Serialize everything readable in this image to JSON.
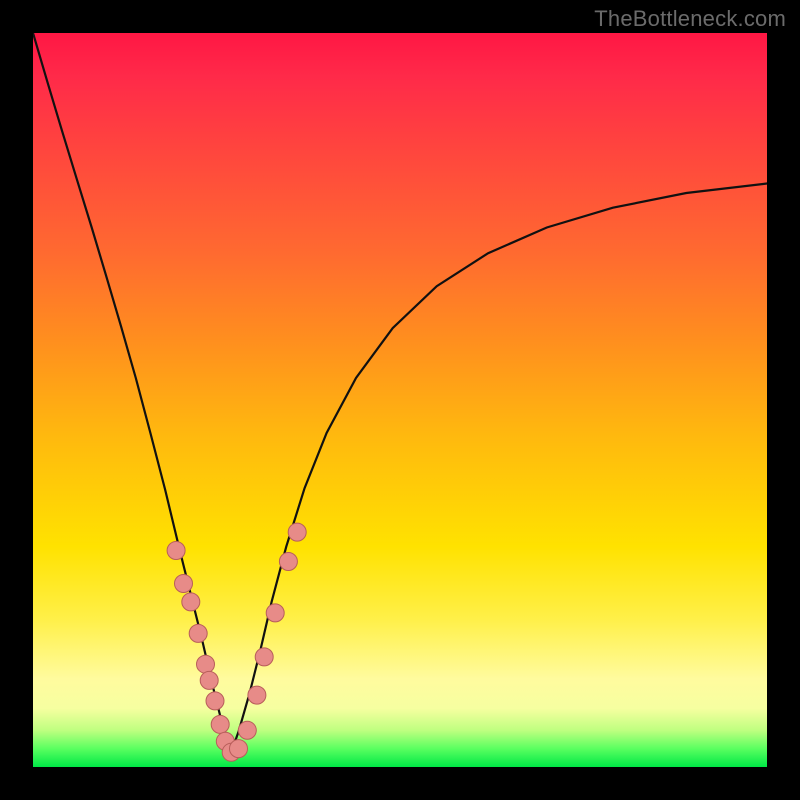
{
  "watermark": "TheBottleneck.com",
  "colors": {
    "frame": "#000000",
    "curve": "#111111",
    "dot_fill": "#e78b88",
    "dot_stroke": "#b85e5a",
    "gradient_stops": [
      {
        "pos": 0.0,
        "color": "#ff1744"
      },
      {
        "pos": 0.06,
        "color": "#ff2a49"
      },
      {
        "pos": 0.14,
        "color": "#ff4040"
      },
      {
        "pos": 0.3,
        "color": "#ff6a30"
      },
      {
        "pos": 0.42,
        "color": "#ff8f1e"
      },
      {
        "pos": 0.55,
        "color": "#ffb90e"
      },
      {
        "pos": 0.7,
        "color": "#ffe200"
      },
      {
        "pos": 0.8,
        "color": "#fff04a"
      },
      {
        "pos": 0.88,
        "color": "#fffb9e"
      },
      {
        "pos": 0.92,
        "color": "#f6ffa0"
      },
      {
        "pos": 0.95,
        "color": "#bfff80"
      },
      {
        "pos": 0.975,
        "color": "#5aff60"
      },
      {
        "pos": 1.0,
        "color": "#00e846"
      }
    ]
  },
  "chart_data": {
    "type": "line",
    "title": "",
    "xlabel": "",
    "ylabel": "",
    "xlim": [
      0,
      1
    ],
    "ylim": [
      0,
      1
    ],
    "vertex_x": 0.27,
    "series": [
      {
        "name": "bottleneck-curve",
        "x": [
          0.0,
          0.02,
          0.04,
          0.06,
          0.08,
          0.1,
          0.12,
          0.14,
          0.16,
          0.18,
          0.2,
          0.215,
          0.23,
          0.245,
          0.26,
          0.27,
          0.28,
          0.295,
          0.31,
          0.325,
          0.345,
          0.37,
          0.4,
          0.44,
          0.49,
          0.55,
          0.62,
          0.7,
          0.79,
          0.89,
          1.0
        ],
        "y": [
          1.0,
          0.932,
          0.865,
          0.8,
          0.735,
          0.668,
          0.6,
          0.53,
          0.455,
          0.378,
          0.295,
          0.235,
          0.175,
          0.11,
          0.05,
          0.02,
          0.048,
          0.1,
          0.16,
          0.225,
          0.3,
          0.38,
          0.455,
          0.53,
          0.598,
          0.655,
          0.7,
          0.735,
          0.762,
          0.782,
          0.795
        ]
      }
    ],
    "scatter": {
      "name": "sample-dots",
      "points": [
        {
          "x": 0.195,
          "y": 0.295
        },
        {
          "x": 0.205,
          "y": 0.25
        },
        {
          "x": 0.215,
          "y": 0.225
        },
        {
          "x": 0.225,
          "y": 0.182
        },
        {
          "x": 0.235,
          "y": 0.14
        },
        {
          "x": 0.24,
          "y": 0.118
        },
        {
          "x": 0.248,
          "y": 0.09
        },
        {
          "x": 0.255,
          "y": 0.058
        },
        {
          "x": 0.262,
          "y": 0.035
        },
        {
          "x": 0.27,
          "y": 0.02
        },
        {
          "x": 0.28,
          "y": 0.025
        },
        {
          "x": 0.292,
          "y": 0.05
        },
        {
          "x": 0.305,
          "y": 0.098
        },
        {
          "x": 0.315,
          "y": 0.15
        },
        {
          "x": 0.33,
          "y": 0.21
        },
        {
          "x": 0.348,
          "y": 0.28
        },
        {
          "x": 0.36,
          "y": 0.32
        }
      ]
    }
  }
}
